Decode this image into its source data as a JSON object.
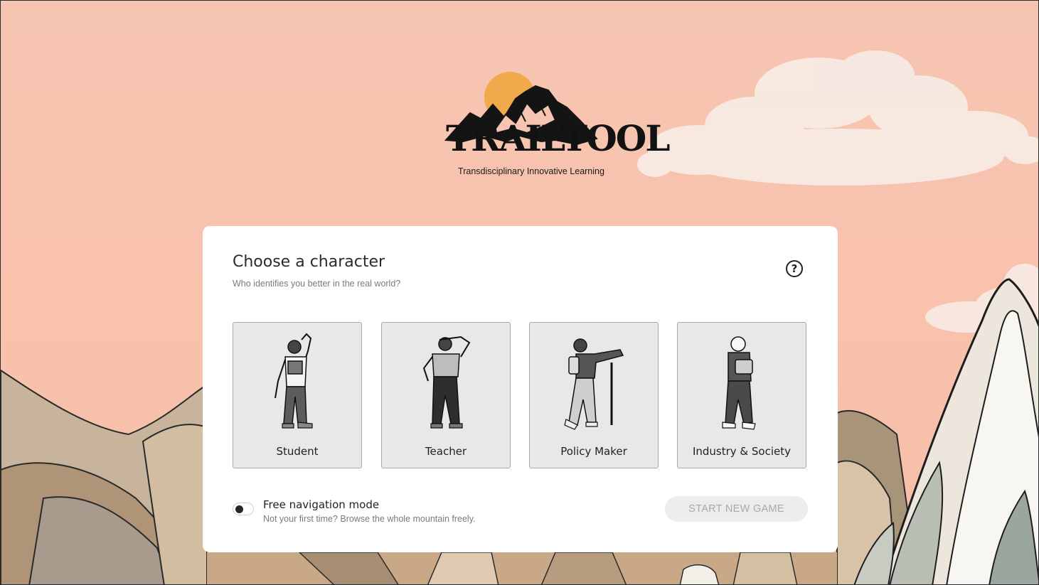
{
  "logo": {
    "title": "TRAILTOOL",
    "subtitle": "Transdisciplinary Innovative Learning"
  },
  "dialog": {
    "title": "Choose a character",
    "subtitle": "Who identifies you better in the real world?",
    "help_icon": "question-circle-icon",
    "help_symbol": "?",
    "characters": [
      {
        "label": "Student",
        "icon": "student-figure"
      },
      {
        "label": "Teacher",
        "icon": "teacher-figure"
      },
      {
        "label": "Policy Maker",
        "icon": "policy-maker-figure"
      },
      {
        "label": "Industry & Society",
        "icon": "industry-society-figure"
      }
    ],
    "free_navigation": {
      "label": "Free navigation mode",
      "description": "Not your first time? Browse the whole mountain freely.",
      "enabled": false
    },
    "start_button": {
      "label": "START NEW GAME",
      "enabled": false
    }
  },
  "colors": {
    "sky": "#f6c5b1",
    "sun": "#f0a94b",
    "card": "#ffffff",
    "tile": "#e8e8e8",
    "button_disabled": "#ececec",
    "button_text_disabled": "#a9a9a9"
  }
}
